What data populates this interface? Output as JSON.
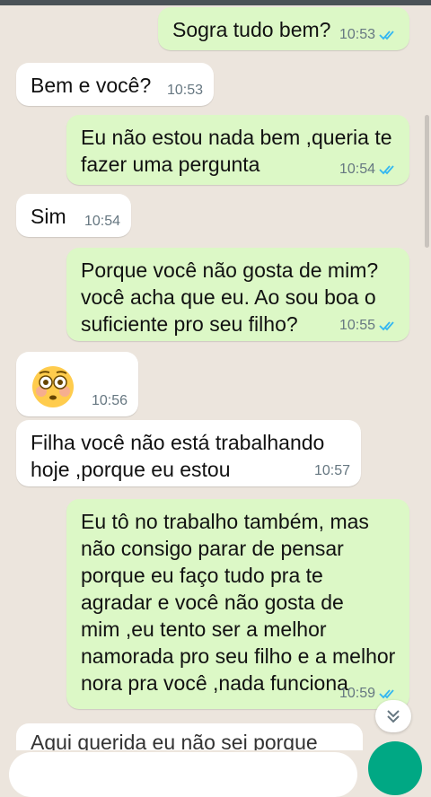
{
  "messages": [
    {
      "text": "Sogra tudo bem?",
      "time": "10:53",
      "dir": "out"
    },
    {
      "text": "Bem e você?",
      "time": "10:53",
      "dir": "in"
    },
    {
      "text": "Eu não estou nada bem ,queria te\nfazer uma pergunta",
      "time": "10:54",
      "dir": "out"
    },
    {
      "text": "Sim",
      "time": "10:54",
      "dir": "in"
    },
    {
      "text": "Porque você não gosta de mim?\nvocê acha que eu. Ao sou boa o\nsuficiente pro seu filho?",
      "time": "10:55",
      "dir": "out"
    },
    {
      "text": "",
      "emoji": "flushed-face",
      "time": "10:56",
      "dir": "in"
    },
    {
      "text": "Filha você não está trabalhando\nhoje ,porque eu estou",
      "time": "10:57",
      "dir": "in"
    },
    {
      "text": "Eu tô no trabalho também, mas\nnão consigo parar de pensar\nporque eu faço tudo pra te\nagradar  e você não gosta de\nmim ,eu tento ser a melhor\nnamorada pro seu filho e a melhor\nnora pra você ,nada funciona",
      "time": "10:59",
      "dir": "out"
    },
    {
      "text": "Aqui querida eu não sei porque",
      "dir": "in",
      "partial": true
    }
  ],
  "icons": {
    "read_receipt": "double-check-icon",
    "scroll": "chevron-double-down-icon"
  },
  "colors": {
    "background": "#ECE5DD",
    "outgoing": "#DCF8C6",
    "incoming": "#FFFFFF",
    "read_tick": "#34B7F1",
    "fab": "#00A884"
  }
}
